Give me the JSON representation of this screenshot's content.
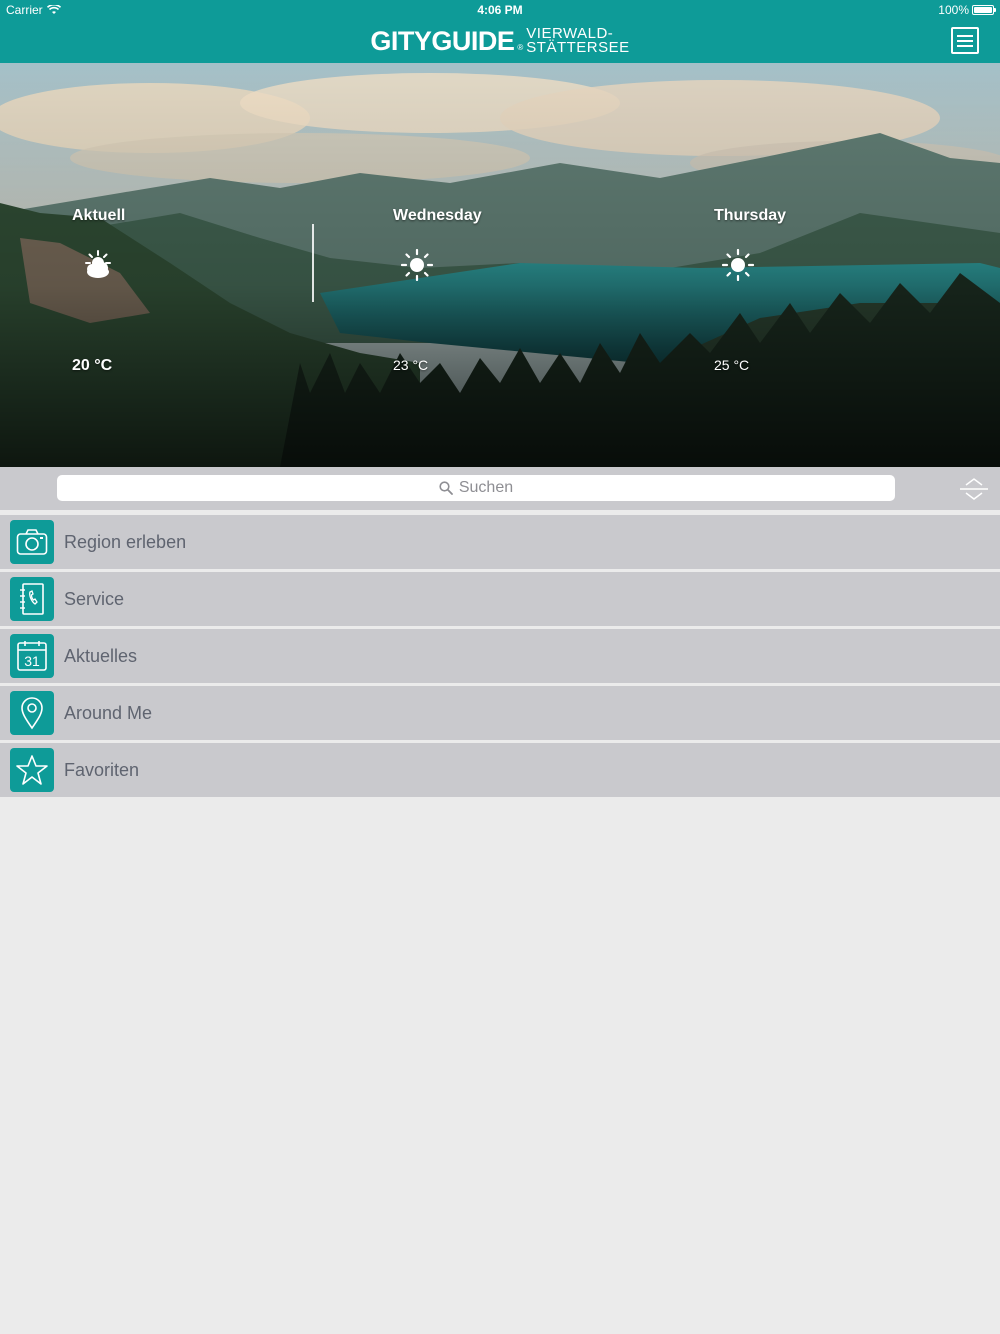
{
  "status_bar": {
    "carrier": "Carrier",
    "time": "4:06 PM",
    "battery": "100%"
  },
  "header": {
    "brand": "GITYGUIDE",
    "brand_mark": "®",
    "subtitle_line1": "VIERWALD-",
    "subtitle_line2": "STÄTTERSEE",
    "menu_icon": "hamburger-menu-icon"
  },
  "colors": {
    "accent": "#0e9b98",
    "list_bg": "#c9c9cd",
    "page_bg": "#ebebeb",
    "label": "#5f6470"
  },
  "weather": [
    {
      "day": "Aktuell",
      "temp": "20 °C",
      "icon": "partly-cloudy-icon"
    },
    {
      "day": "Wednesday",
      "temp": "23 °C",
      "icon": "sun-icon"
    },
    {
      "day": "Thursday",
      "temp": "25 °C",
      "icon": "sun-icon"
    }
  ],
  "search": {
    "placeholder": "Suchen",
    "icon": "search-icon",
    "sort_icon": "sort-chevrons-icon"
  },
  "menu": [
    {
      "label": "Region erleben",
      "icon": "camera-icon"
    },
    {
      "label": "Service",
      "icon": "phone-book-icon"
    },
    {
      "label": "Aktuelles",
      "icon": "calendar-icon",
      "icon_text": "31"
    },
    {
      "label": "Around Me",
      "icon": "location-pin-icon"
    },
    {
      "label": "Favoriten",
      "icon": "star-icon"
    }
  ]
}
